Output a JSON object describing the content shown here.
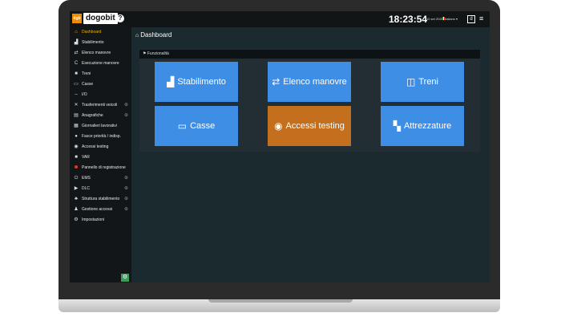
{
  "app": {
    "logo_mark": "dgb",
    "name": "dogobit",
    "help": "?"
  },
  "topbar": {
    "time": "18:23:54",
    "date": "10 set 2025",
    "language": "Italiano ▾",
    "user_initial": "d",
    "menu_icon": "hamburger-icon"
  },
  "sidebar": {
    "items": [
      {
        "label": "Dashboard",
        "icon": "home-icon"
      },
      {
        "label": "Stabilimento",
        "icon": "factory-icon"
      },
      {
        "label": "Elenco manovre",
        "icon": "swap-icon"
      },
      {
        "label": "Esecuzione manovre",
        "icon": "c-icon"
      },
      {
        "label": "Treni",
        "icon": "train-icon"
      },
      {
        "label": "Casse",
        "icon": "box-icon"
      },
      {
        "label": "I/O",
        "icon": "dash-icon"
      },
      {
        "label": "Trasferimenti veicoli",
        "icon": "shuffle-icon"
      },
      {
        "label": "Anagrafiche",
        "icon": "list-icon"
      },
      {
        "label": "Giornalieri lavorativi",
        "icon": "calendar-icon"
      },
      {
        "label": "Fasce priorità / indisp.",
        "icon": "info-icon"
      },
      {
        "label": "Accessi testing",
        "icon": "user-icon"
      },
      {
        "label": "VAR",
        "icon": "camera-icon"
      },
      {
        "label": "Pannello di registrazione",
        "icon": "record-icon"
      },
      {
        "label": "EMS",
        "icon": "power-icon"
      },
      {
        "label": "DLC",
        "icon": "play-icon"
      },
      {
        "label": "Struttura stabilimento",
        "icon": "sitemap-icon"
      },
      {
        "label": "Gestione accessi",
        "icon": "users-icon"
      },
      {
        "label": "Impostazioni",
        "icon": "gear-icon"
      }
    ]
  },
  "main": {
    "page_title": "Dashboard",
    "panel_title": "Funzionalità",
    "tiles": [
      {
        "label": "Stabilimento",
        "icon": "factory-icon"
      },
      {
        "label": "Elenco manovre",
        "icon": "swap-icon"
      },
      {
        "label": "Treni",
        "icon": "train-icon"
      },
      {
        "label": "Casse",
        "icon": "box-icon"
      },
      {
        "label": "Accessi testing",
        "icon": "user-icon"
      },
      {
        "label": "Attrezzature",
        "icon": "grid-icon"
      }
    ]
  },
  "colors": {
    "tile_blue": "#3f8ee6",
    "tile_orange": "#c36f1e",
    "active_accent": "#f0b400",
    "background": "#1b2a2f"
  }
}
